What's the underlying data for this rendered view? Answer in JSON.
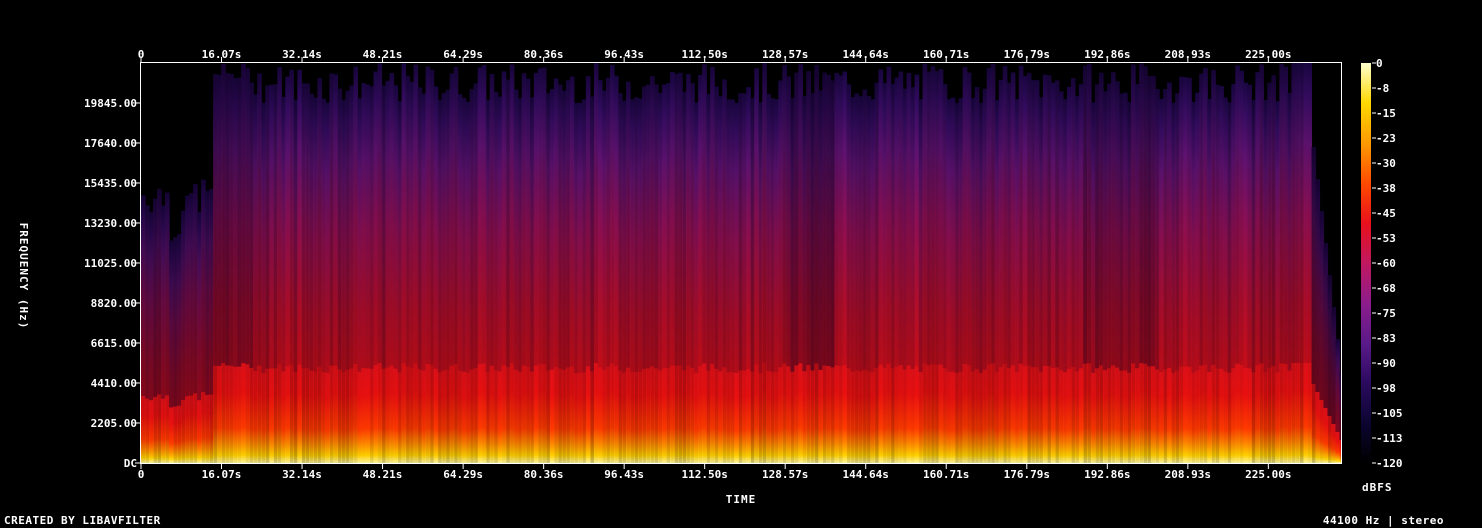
{
  "chart_data": {
    "type": "heatmap",
    "title": "",
    "xlabel": "TIME",
    "ylabel": "FREQUENCY (Hz)",
    "x_ticks": [
      "0",
      "16.07s",
      "32.14s",
      "48.21s",
      "64.29s",
      "80.36s",
      "96.43s",
      "112.50s",
      "128.57s",
      "144.64s",
      "160.71s",
      "176.79s",
      "192.86s",
      "208.93s",
      "225.00s"
    ],
    "x_tick_seconds": [
      0,
      16.07,
      32.14,
      48.21,
      64.29,
      80.36,
      96.43,
      112.5,
      128.57,
      144.64,
      160.71,
      176.79,
      192.86,
      208.93,
      225.0
    ],
    "xlim": [
      0,
      239.5
    ],
    "y_ticks": [
      "DC",
      "2205.00",
      "4410.00",
      "6615.00",
      "8820.00",
      "11025.00",
      "13230.00",
      "15435.00",
      "17640.00",
      "19845.00"
    ],
    "y_tick_hz": [
      0,
      2205,
      4410,
      6615,
      8820,
      11025,
      13230,
      15435,
      17640,
      19845
    ],
    "ylim": [
      0,
      22050
    ],
    "colorbar": {
      "label": "dBFS",
      "ticks": [
        "0",
        "-8",
        "-15",
        "-23",
        "-30",
        "-38",
        "-45",
        "-53",
        "-60",
        "-68",
        "-75",
        "-83",
        "-90",
        "-98",
        "-105",
        "-113",
        "-120"
      ],
      "range": [
        -120,
        0
      ],
      "colormap": [
        "#000000",
        "#0b0530",
        "#2a0a5e",
        "#5a1a8a",
        "#8c1c8c",
        "#c01860",
        "#e8101c",
        "#ff4a00",
        "#ff9a00",
        "#ffd800",
        "#ffffd0"
      ]
    },
    "legend": "right",
    "grid": false
  },
  "footer": {
    "left": "CREATED BY LIBAVFILTER",
    "right": "44100 Hz | stereo"
  }
}
